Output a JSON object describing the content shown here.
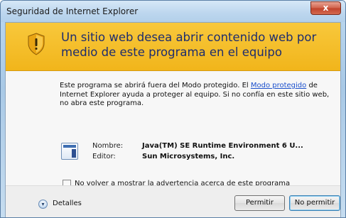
{
  "window": {
    "title": "Seguridad de Internet Explorer",
    "close_glyph": "x"
  },
  "banner": {
    "icon": "warning-shield-icon",
    "title": "Un sitio web desea abrir contenido web por medio de este programa en el equipo"
  },
  "description": {
    "text_before_link": "Este programa se abrirá fuera del Modo protegido. El ",
    "link_text": "Modo protegido",
    "text_after_link": " de Internet Explorer ayuda a proteger al equipo. Si no confía en este sitio web, no abra este programa."
  },
  "program": {
    "icon": "application-window-icon",
    "name_label": "Nombre:",
    "name_value": "Java(TM) SE Runtime Environment 6 U...",
    "publisher_label": "Editor:",
    "publisher_value": "Sun Microsystems, Inc."
  },
  "checkbox": {
    "label": "No volver a mostrar la advertencia acerca de este programa",
    "checked": false
  },
  "footer": {
    "details_label": "Detalles",
    "details_icon": "chevron-down-circle-icon",
    "allow_label": "Permitir",
    "deny_label": "No permitir"
  },
  "colors": {
    "banner": "#f3b825",
    "title_text": "#1e2d6e",
    "link": "#1a4fcc"
  }
}
